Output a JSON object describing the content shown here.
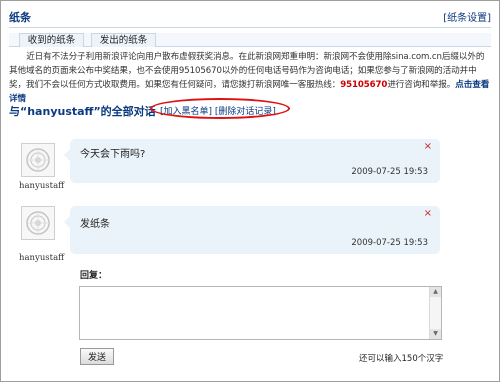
{
  "header": {
    "title": "纸条",
    "settings_link": "[纸条设置]"
  },
  "tabs": [
    {
      "label": "收到的纸条"
    },
    {
      "label": "发出的纸条"
    }
  ],
  "notice": {
    "text": "近日有不法分子利用新浪评论向用户散布虚假获奖消息。在此新浪网郑重申明：新浪网不会使用除sina.com.cn后缀以外的其他域名的页面来公布中奖结果，也不会使用95105670以外的任何电话号码作为咨询电话；如果您参与了新浪网的活动并中奖，我们不会以任何方式收取费用。如果您有任何疑问，请您拨打新浪网唯一客服热线：",
    "hotline": "95105670",
    "after_hotline": "进行咨询和举报。",
    "details_link": "点击查看详情"
  },
  "conversation": {
    "title": "与“hanyustaff”的全部对话",
    "blacklist_link": "[加入黑名单]",
    "delete_link": "[删除对话记录]",
    "highlight_color": "#dd1111"
  },
  "messages": [
    {
      "user": "hanyustaff",
      "text": "今天会下雨吗?",
      "time": "2009-07-25  19:53",
      "close": "×"
    },
    {
      "user": "hanyustaff",
      "text": "发纸条",
      "time": "2009-07-25  19:53",
      "close": "×"
    }
  ],
  "reply": {
    "label": "回复：",
    "value": "",
    "send_label": "发送",
    "remaining_text": "还可以输入150个汉字"
  },
  "colors": {
    "link": "#0b3a80",
    "bubble": "#eaf3f9",
    "alert": "#cc0000"
  }
}
